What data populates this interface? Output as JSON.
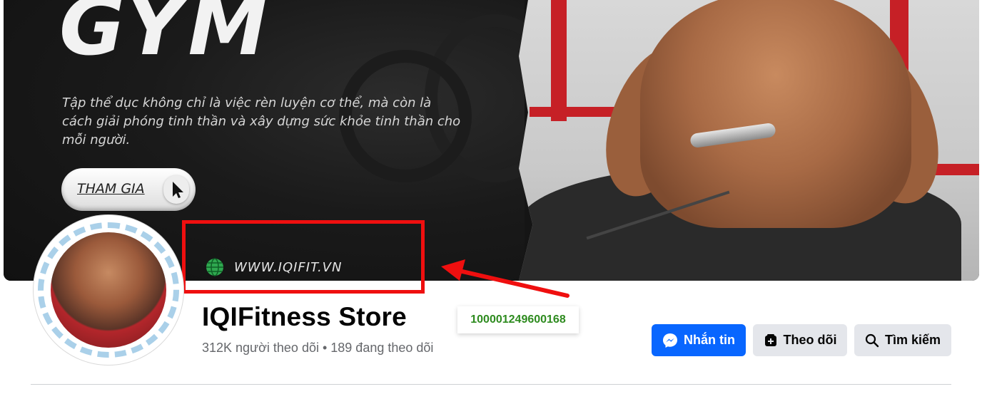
{
  "cover": {
    "heading": "GYM",
    "tagline": "Tập thể dục không chỉ là việc rèn luyện cơ thể, mà còn là cách giải phóng tinh thần và xây dựng sức khỏe tinh thần cho mỗi người.",
    "join_button": "THAM GIA",
    "website": "WWW.IQIFIT.VN",
    "accent_color": "#c62026"
  },
  "annotation": {
    "box_color": "#ef0f0f",
    "id_badge": "100001249600168",
    "id_color": "#2e8b1f"
  },
  "profile": {
    "name": "IQIFitness Store",
    "stats": "312K người theo dõi • 189 đang theo dõi"
  },
  "actions": {
    "message_label": "Nhắn tin",
    "follow_label": "Theo dõi",
    "search_label": "Tìm kiếm",
    "primary_color": "#0866ff",
    "secondary_color": "#e4e6eb"
  }
}
